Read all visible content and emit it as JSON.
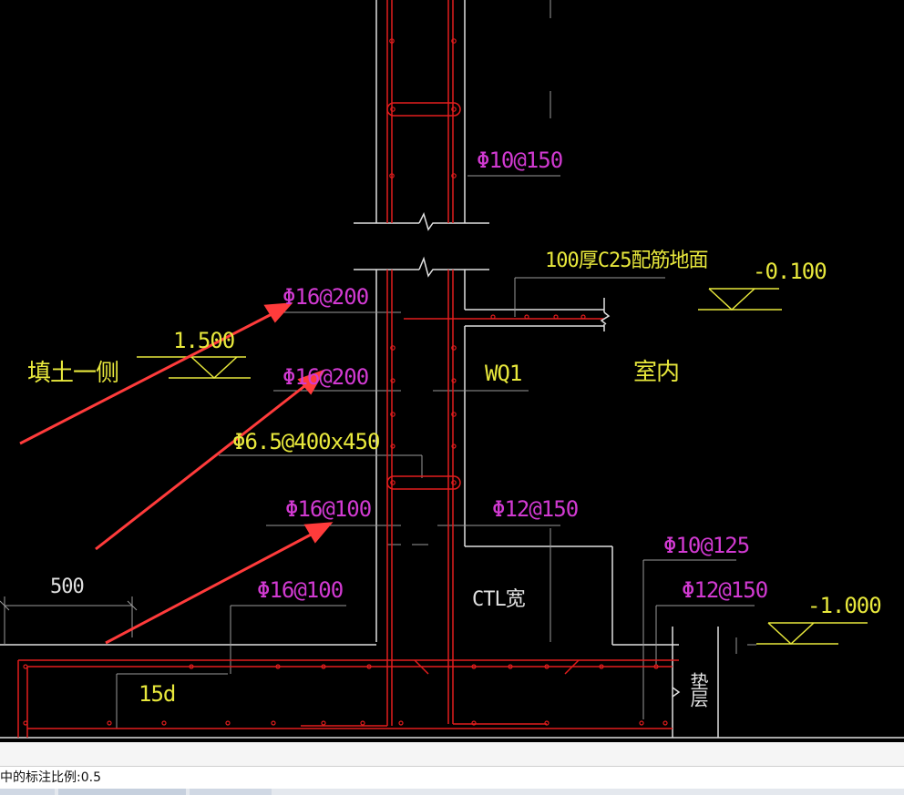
{
  "labels": {
    "rebar_phi10_150": "Φ10@150",
    "slab_note": "100厚C25配筋地面",
    "elev_minus_0100": "-0.100",
    "rebar_phi16_200_a": "Φ16@200",
    "elev_1500": "1.500",
    "fill_side": "填土一侧",
    "rebar_phi16_200_b": "Φ16@200",
    "wall_id": "WQ1",
    "indoor": "室内",
    "rebar_phi6_5": "Φ6.5@400x450",
    "rebar_phi16_100_a": "Φ16@100",
    "rebar_phi12_150_a": "Φ12@150",
    "rebar_phi10_125": "Φ10@125",
    "dim_500": "500",
    "rebar_phi16_100_b": "Φ16@100",
    "ctl_width": "CTL宽",
    "rebar_phi12_150_b": "Φ12@150",
    "elev_minus_1000": "-1.000",
    "anchor_15d": "15d",
    "side_note": "垫层"
  },
  "command_line": {
    "text": "中的标注比例:0.5"
  },
  "colors": {
    "background": "#000000",
    "rebar": "#e21d1d",
    "annotation_magenta": "#d23ad2",
    "annotation_yellow": "#e8e83c",
    "outline_white": "#e0e0e0",
    "arrow": "#ff3b3b"
  }
}
